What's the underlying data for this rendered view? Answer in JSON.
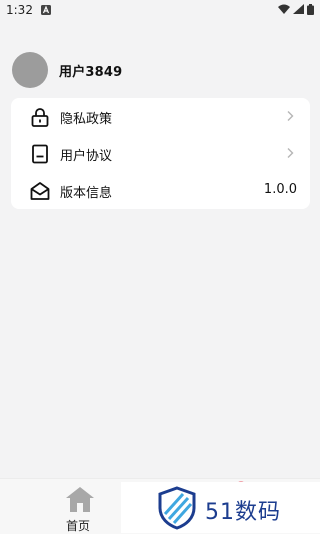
{
  "status_bar": {
    "time": "1:32",
    "app_icon": "notification-app-icon",
    "right_icons": [
      "wifi-icon",
      "signal-icon",
      "battery-icon"
    ]
  },
  "profile": {
    "username": "用户3849",
    "avatar_color": "#9c9c9c"
  },
  "menu": {
    "items": [
      {
        "label": "隐私政策",
        "icon": "lock-icon",
        "chevron": true
      },
      {
        "label": "用户协议",
        "icon": "document-icon",
        "chevron": true
      },
      {
        "label": "版本信息",
        "icon": "envelope-open-icon",
        "value": "1.0.0"
      }
    ]
  },
  "bottom_nav": {
    "home_label": "首页",
    "home_icon": "home-icon"
  },
  "watermark": {
    "text": "51数码",
    "color": "#1c3d8f"
  }
}
